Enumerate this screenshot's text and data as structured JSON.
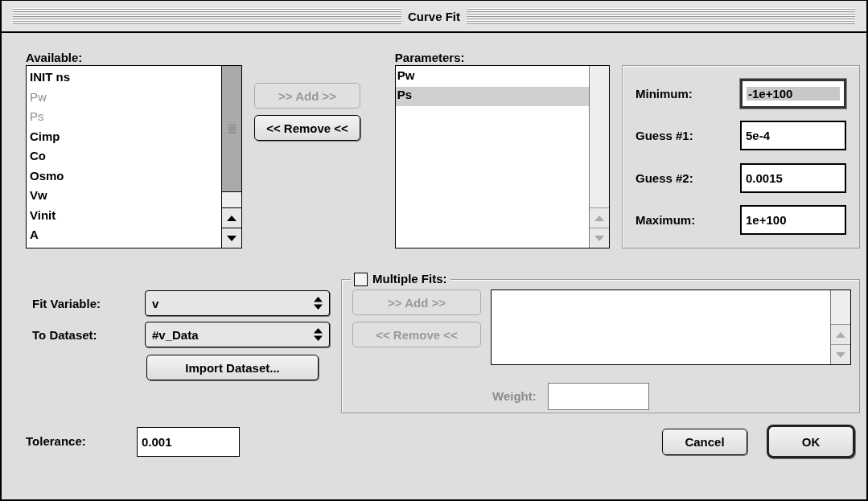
{
  "window": {
    "title": "Curve Fit"
  },
  "available": {
    "label": "Available:",
    "items": [
      {
        "text": "INIT ns",
        "disabled": false
      },
      {
        "text": "Pw",
        "disabled": true
      },
      {
        "text": "Ps",
        "disabled": true
      },
      {
        "text": "Cimp",
        "disabled": false
      },
      {
        "text": "Co",
        "disabled": false
      },
      {
        "text": "Osmo",
        "disabled": false
      },
      {
        "text": "Vw",
        "disabled": false
      },
      {
        "text": "Vinit",
        "disabled": false
      },
      {
        "text": "A",
        "disabled": false
      }
    ]
  },
  "transfer_buttons": [
    {
      "label": ">> Add >>",
      "disabled": true
    },
    {
      "label": "<< Remove <<",
      "disabled": false
    }
  ],
  "parameters": {
    "label": "Parameters:",
    "items": [
      {
        "text": "Pw",
        "selected": false
      },
      {
        "text": "Ps",
        "selected": true
      }
    ]
  },
  "bounds": [
    {
      "label": "Minimum:",
      "value": "-1e+100",
      "focused": true
    },
    {
      "label": "Guess #1:",
      "value": "5e-4",
      "focused": false
    },
    {
      "label": "Guess #2:",
      "value": "0.0015",
      "focused": false
    },
    {
      "label": "Maximum:",
      "value": "1e+100",
      "focused": false
    }
  ],
  "popups": [
    {
      "label": "Fit Variable:",
      "value": "v"
    },
    {
      "label": "To Dataset:",
      "value": "#v_Data"
    }
  ],
  "import_button": {
    "label": "Import Dataset..."
  },
  "multiple_fits": {
    "label": "Multiple Fits:",
    "checked": false,
    "buttons": [
      {
        "label": ">> Add >>",
        "disabled": true
      },
      {
        "label": "<< Remove <<",
        "disabled": true
      }
    ],
    "weight": {
      "label": "Weight:",
      "disabled": true
    }
  },
  "tolerance": {
    "label": "Tolerance:",
    "value": "0.001"
  },
  "dialog_buttons": [
    {
      "label": "Cancel",
      "default": false
    },
    {
      "label": "OK",
      "default": true
    }
  ]
}
